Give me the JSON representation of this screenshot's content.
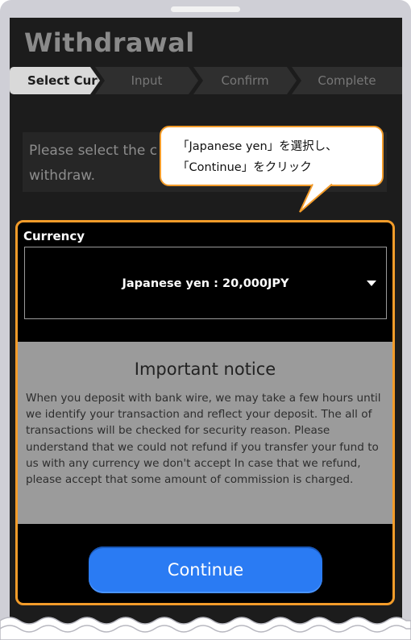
{
  "page": {
    "title": "Withdrawal"
  },
  "steps": [
    {
      "label": "Select Currency",
      "active": true
    },
    {
      "label": "Input",
      "active": false
    },
    {
      "label": "Confirm",
      "active": false
    },
    {
      "label": "Complete",
      "active": false
    }
  ],
  "instruction": {
    "line1": "Please select the c",
    "line2": "withdraw."
  },
  "callout": {
    "line1": "「Japanese yen」を選択し、",
    "line2": "「Continue」をクリック"
  },
  "currency": {
    "label": "Currency",
    "selected": "Japanese yen : 20,000JPY"
  },
  "notice": {
    "title": "Important notice",
    "body": "When you deposit with bank wire, we may take a few hours until we identify your transaction and reflect your deposit. The all of transactions will be checked for security reason. Please understand that we could not refund if you transfer your fund to us with any currency we don't accept In case that we refund, please accept that some amount of commission is charged."
  },
  "buttons": {
    "continue": "Continue"
  },
  "colors": {
    "accent_orange": "#f39c2a",
    "button_blue": "#2a7bf3",
    "screen_bg": "#1c1c1c",
    "notice_bg": "#9b9b9b"
  }
}
